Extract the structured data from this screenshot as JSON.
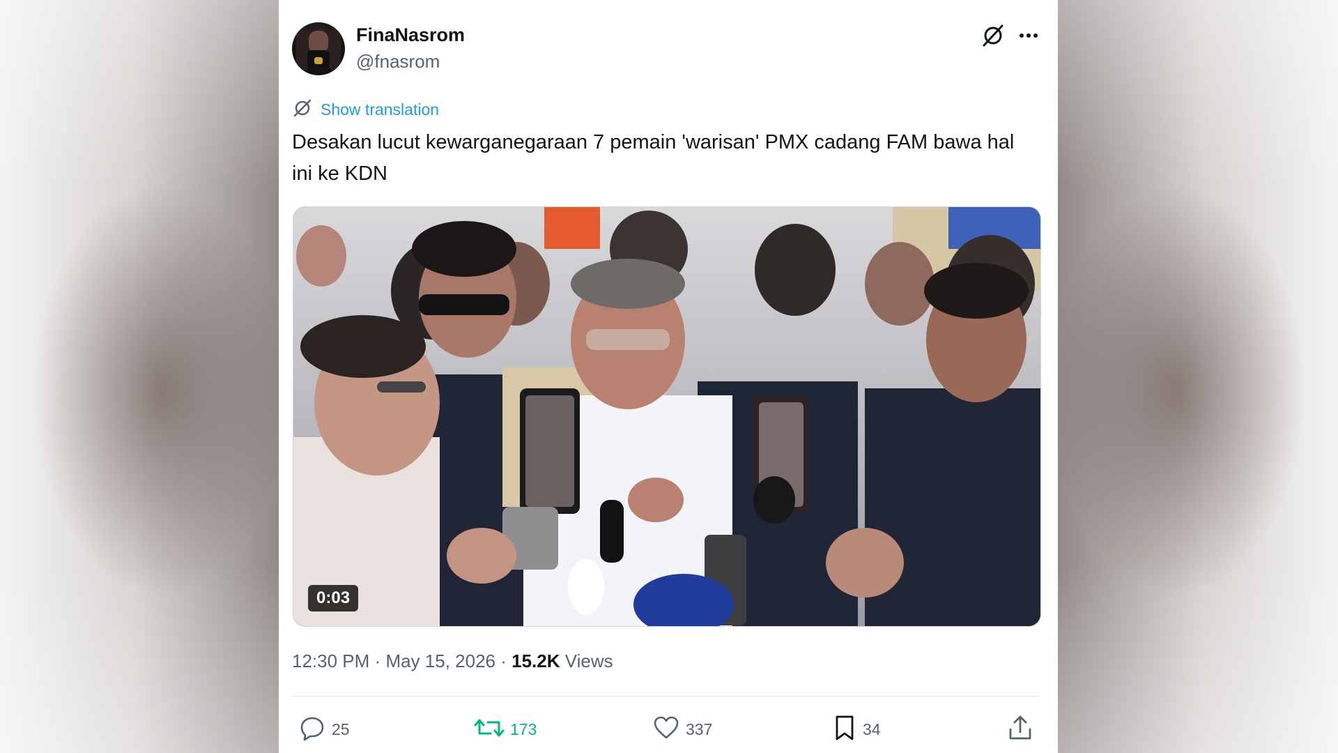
{
  "author": {
    "display_name": "FinaNasrom",
    "handle": "@fnasrom"
  },
  "header_icons": [
    "grok-icon",
    "more-icon"
  ],
  "translation": {
    "label": "Show translation",
    "icon": "translate-icon"
  },
  "tweet": {
    "text": "Desakan lucut kewarganegaraan 7 pemain 'warisan' PMX cadang FAM bawa hal ini ke KDN"
  },
  "media": {
    "type": "video",
    "duration": "0:03"
  },
  "meta": {
    "time": "12:30 PM",
    "separator": "·",
    "date": "May 15, 2026",
    "views_count": "15.2K",
    "views_label": "Views"
  },
  "actions": {
    "replies": "25",
    "reposts": "173",
    "likes": "337",
    "bookmarks": "34"
  },
  "colors": {
    "accent": "#1d9bf0",
    "repost_green": "#00ba7c",
    "text_primary": "#0f1419",
    "text_secondary": "#536471"
  }
}
